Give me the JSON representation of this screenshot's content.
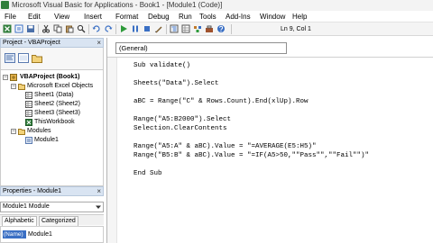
{
  "window": {
    "title": "Microsoft Visual Basic for Applications - Book1 - [Module1 (Code)]"
  },
  "menu": [
    "File",
    "Edit",
    "View",
    "Insert",
    "Format",
    "Debug",
    "Run",
    "Tools",
    "Add-Ins",
    "Window",
    "Help"
  ],
  "toolbar": {
    "buttons": [
      "view-excel-icon",
      "insert-module-icon",
      "save-icon",
      "cut-icon",
      "copy-icon",
      "paste-icon",
      "find-icon",
      "undo-icon",
      "redo-icon",
      "run-icon",
      "break-icon",
      "reset-icon",
      "design-mode-icon",
      "project-explorer-icon",
      "properties-icon",
      "object-browser-icon",
      "toolbox-icon",
      "help-icon"
    ],
    "status": "Ln 9, Col 1"
  },
  "project_pane": {
    "title": "Project - VBAProject",
    "close_glyph": "×",
    "tree": {
      "root": "VBAProject (Book1)",
      "objects_folder": "Microsoft Excel Objects",
      "sheets": [
        "Sheet1 (Data)",
        "Sheet2 (Sheet2)",
        "Sheet3 (Sheet3)",
        "ThisWorkbook"
      ],
      "modules_folder": "Modules",
      "modules": [
        "Module1"
      ]
    }
  },
  "properties_pane": {
    "title": "Properties - Module1",
    "close_glyph": "×",
    "combo": "Module1 Module",
    "tabs": [
      "Alphabetic",
      "Categorized"
    ],
    "row": {
      "key": "(Name)",
      "value": "Module1"
    }
  },
  "code_window": {
    "object_combo": "(General)",
    "lines": [
      "Sub validate()",
      "",
      "Sheets(\"Data\").Select",
      "",
      "aBC = Range(\"C\" & Rows.Count).End(xlUp).Row",
      "",
      "Range(\"A5:B2000\").Select",
      "Selection.ClearContents",
      "",
      "Range(\"A5:A\" & aBC).Value = \"=AVERAGE(E5:H5)\"",
      "Range(\"B5:B\" & aBC).Value = \"=IF(A5>50,\"\"Pass\"\",\"\"Fail\"\")\"",
      "",
      "End Sub"
    ]
  },
  "colors": {
    "pane_header": "#d9e4f2",
    "selection": "#3a6fc4",
    "excel_green": "#2f7d3a"
  }
}
